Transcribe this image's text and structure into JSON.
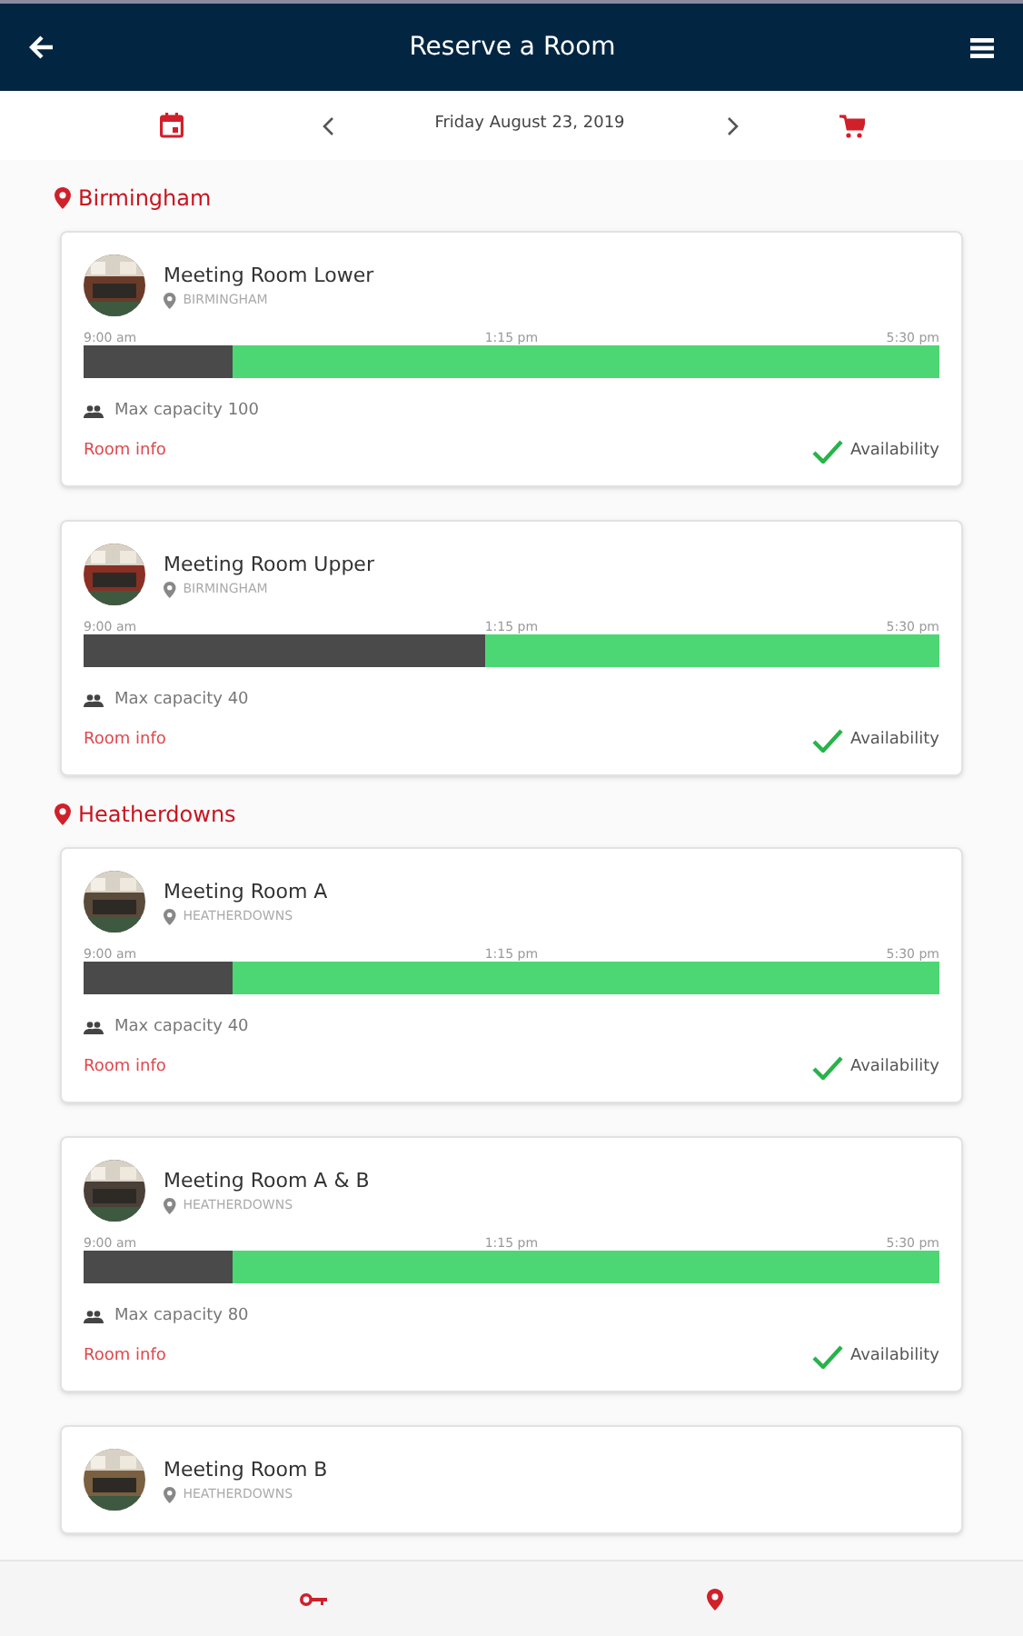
{
  "header": {
    "title": "Reserve a Room"
  },
  "date_bar": {
    "date": "Friday August 23, 2019"
  },
  "locations": [
    {
      "name": "Birmingham",
      "rooms": [
        {
          "name": "Meeting Room Lower",
          "location": "BIRMINGHAM",
          "times": [
            "9:00 am",
            "1:15 pm",
            "5:30 pm"
          ],
          "level": 0.175,
          "capacity": "Max capacity 100",
          "info": "Room info",
          "availability": "Availability"
        },
        {
          "name": "Meeting Room Upper",
          "location": "BIRMINGHAM",
          "times": [
            "9:00 am",
            "1:15 pm",
            "5:30 pm"
          ],
          "level": 0.47,
          "capacity": "Max capacity 40",
          "info": "Room info",
          "availability": "Availability"
        }
      ]
    },
    {
      "name": "Heatherdowns",
      "rooms": [
        {
          "name": "Meeting Room A",
          "location": "HEATHERDOWNS",
          "times": [
            "9:00 am",
            "1:15 pm",
            "5:30 pm"
          ],
          "level": 0.175,
          "capacity": "Max capacity 40",
          "info": "Room info",
          "availability": "Availability"
        },
        {
          "name": "Meeting Room A & B",
          "location": "HEATHERDOWNS",
          "times": [
            "9:00 am",
            "1:15 pm",
            "5:30 pm"
          ],
          "level": 0.175,
          "capacity": "Max capacity 80",
          "info": "Room info",
          "availability": "Availability"
        },
        {
          "name": "Meeting Room B",
          "location": "HEATHERDOWNS"
        }
      ]
    }
  ]
}
